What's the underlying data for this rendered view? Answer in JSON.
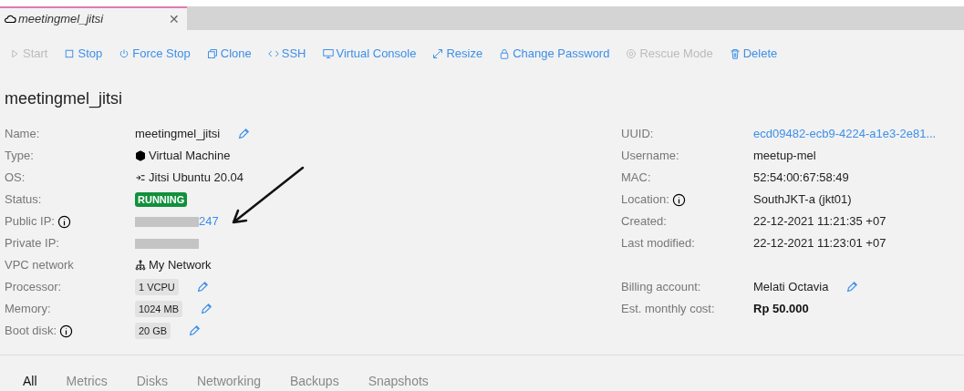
{
  "tab": {
    "title": "meetingmel_jitsi",
    "close": "✕",
    "selected": true
  },
  "toolbar": [
    {
      "label": "Start",
      "disabled": true
    },
    {
      "label": "Stop",
      "disabled": false
    },
    {
      "label": "Force Stop",
      "disabled": false
    },
    {
      "label": "Clone",
      "disabled": false
    },
    {
      "label": "SSH",
      "disabled": false
    },
    {
      "label": "Virtual Console",
      "disabled": false
    },
    {
      "label": "Resize",
      "disabled": false
    },
    {
      "label": "Change Password",
      "disabled": false
    },
    {
      "label": "Rescue Mode",
      "disabled": true
    },
    {
      "label": "Delete",
      "disabled": false
    }
  ],
  "heading": "meetingmel_jitsi",
  "left_rows": [
    {
      "label": "Name:",
      "value": "meetingmel_jitsi",
      "kind": "text",
      "editable": true
    },
    {
      "label": "Type:",
      "value": "Virtual Machine",
      "kind": "text"
    },
    {
      "label": "OS:",
      "value": "Jitsi Ubuntu 20.04",
      "kind": "text"
    },
    {
      "label": "Status:",
      "value": "RUNNING",
      "kind": "status"
    },
    {
      "label": "Public IP:",
      "value": "247",
      "kind": "link",
      "info": true,
      "redacted": true
    },
    {
      "label": "Private IP:",
      "kind": "link",
      "redacted": true
    },
    {
      "label": "VPC network",
      "value": "My Network",
      "kind": "text"
    },
    {
      "label": "Processor:",
      "value": "1 VCPU",
      "kind": "chip",
      "editable": true
    },
    {
      "label": "Memory:",
      "value": "1024 MB",
      "kind": "chip",
      "editable": true
    },
    {
      "label": "Boot disk:",
      "value": "20 GB",
      "kind": "chip",
      "editable": true,
      "info": true
    }
  ],
  "right_rows": [
    {
      "label": "UUID:",
      "value": "ecd09482-ecb9-4224-a1e3-2e81...",
      "kind": "link"
    },
    {
      "label": "Username:",
      "value": "meetup-mel",
      "kind": "text"
    },
    {
      "label": "MAC:",
      "value": "52:54:00:67:58:49",
      "kind": "text"
    },
    {
      "label": "Location:",
      "value": "SouthJKT-a (jkt01)",
      "kind": "text",
      "info": true
    },
    {
      "label": "Created:",
      "value": "22-12-2021 11:21:35 +07",
      "kind": "text"
    },
    {
      "label": "Last modified:",
      "value": "22-12-2021 11:23:01 +07",
      "kind": "text"
    },
    {
      "kind": "spacer"
    },
    {
      "label": "Billing account:",
      "value": "Melati Octavia",
      "kind": "text",
      "editable": true
    },
    {
      "label": "Est. monthly cost:",
      "value": "Rp 50.000",
      "kind": "bold"
    }
  ],
  "tabs": [
    {
      "label": "All",
      "selected": true
    },
    {
      "label": "Metrics",
      "selected": false
    },
    {
      "label": "Disks",
      "selected": false
    },
    {
      "label": "Networking",
      "selected": false
    },
    {
      "label": "Backups",
      "selected": false
    },
    {
      "label": "Snapshots",
      "selected": false
    }
  ]
}
